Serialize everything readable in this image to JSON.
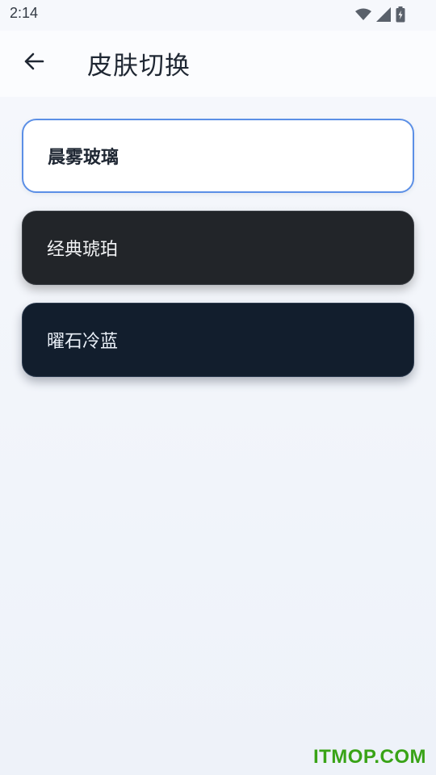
{
  "status_bar": {
    "time": "2:14",
    "icons": [
      "wifi-icon",
      "signal-icon",
      "battery-charging-icon"
    ]
  },
  "app_bar": {
    "back_icon": "arrow-left-icon",
    "title": "皮肤切换"
  },
  "skins": [
    {
      "label": "晨雾玻璃",
      "selected": true,
      "background": "#ffffff",
      "border": "#5b8fe6"
    },
    {
      "label": "经典琥珀",
      "selected": false,
      "background": "#222529"
    },
    {
      "label": "曜石冷蓝",
      "selected": false,
      "background": "#121e2d"
    }
  ],
  "watermark": "ITMOP.COM",
  "colors": {
    "accent": "#5b8fe6",
    "watermark": "#39a317"
  }
}
